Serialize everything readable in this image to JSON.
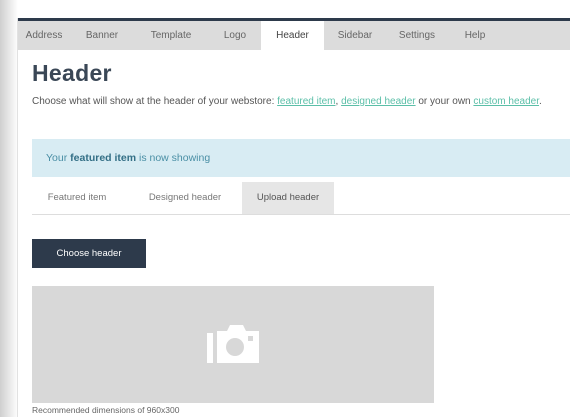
{
  "nav": {
    "tabs": [
      {
        "label": "Address"
      },
      {
        "label": "Banner"
      },
      {
        "label": "Template"
      },
      {
        "label": "Logo"
      },
      {
        "label": "Header"
      },
      {
        "label": "Sidebar"
      },
      {
        "label": "Settings"
      },
      {
        "label": "Help"
      }
    ],
    "active": "Header"
  },
  "page": {
    "title": "Header",
    "description_prefix": "Choose what will show at the header of your webstore: ",
    "link_featured": "featured item",
    "sep": ", ",
    "link_designed": "designed header",
    "or_text": " or your own ",
    "link_custom": "custom header",
    "period": "."
  },
  "alert": {
    "prefix": "Your ",
    "bold": "featured item",
    "suffix": " is now showing"
  },
  "sub_tabs": {
    "tabs": [
      {
        "label": "Featured item"
      },
      {
        "label": "Designed header"
      },
      {
        "label": "Upload header"
      }
    ],
    "active": "Upload header"
  },
  "upload": {
    "button_label": "Choose header",
    "placeholder_icon": "camera-icon",
    "recommendation": "Recommended dimensions of 960x300"
  },
  "colors": {
    "accent_dark": "#2d3a4b",
    "link": "#5bbfa8",
    "alert_bg": "#d8ecf3",
    "alert_text": "#4a8fa5"
  }
}
